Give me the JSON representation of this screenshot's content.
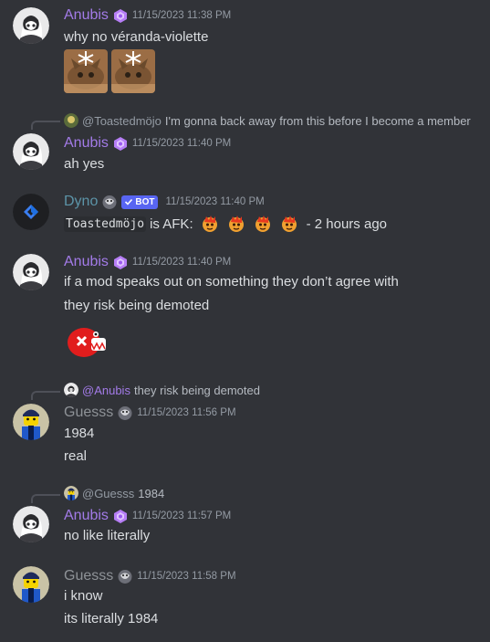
{
  "messages": [
    {
      "author": "Anubis",
      "timestamp": "11/15/2023 11:38 PM",
      "lines": [
        "why no véranda-violette"
      ],
      "attachments": [
        "image-cat-1",
        "image-cat-2"
      ]
    },
    {
      "reply_to": {
        "name": "@Toastedmöjo",
        "text": "I'm gonna back away from this before I become a member"
      },
      "author": "Anubis",
      "timestamp": "11/15/2023 11:40 PM",
      "lines": [
        "ah yes"
      ]
    },
    {
      "author": "Dyno",
      "bot_tag": "BOT",
      "timestamp": "11/15/2023 11:40 PM",
      "afk_user": "Toastedmöjo",
      "afk_text": "is AFK:",
      "afk_suffix": "- 2 hours ago"
    },
    {
      "author": "Anubis",
      "timestamp": "11/15/2023 11:40 PM",
      "lines": [
        "if a mod speaks out on something they don’t agree with",
        "they risk being demoted"
      ]
    },
    {
      "reply_to": {
        "name": "@Anubis",
        "text": "they risk being demoted"
      },
      "author": "Guesss",
      "timestamp": "11/15/2023 11:56 PM",
      "lines": [
        "1984",
        "real"
      ]
    },
    {
      "reply_to": {
        "name": "@Guesss",
        "text": "1984"
      },
      "author": "Anubis",
      "timestamp": "11/15/2023 11:57 PM",
      "lines": [
        "no like literally"
      ]
    },
    {
      "author": "Guesss",
      "timestamp": "11/15/2023 11:58 PM",
      "lines": [
        "i know",
        "its literally 1984"
      ]
    }
  ],
  "colors": {
    "background": "#313338",
    "anubis_name": "#a37be8",
    "dyno_name": "#5c94a8",
    "guess_name": "#8e9297",
    "timestamp": "#949ba4",
    "text": "#dbdee1",
    "bot_tag": "#5865f2"
  }
}
